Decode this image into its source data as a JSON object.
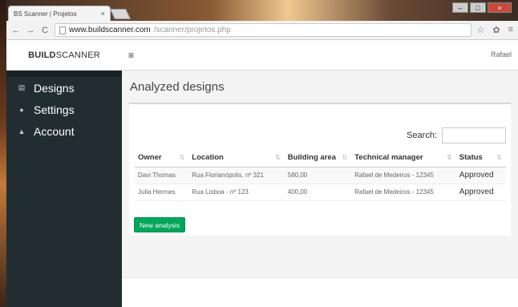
{
  "browser": {
    "tab_title": "BS Scanner | Projetos",
    "tab_close": "×",
    "url_host": "www.buildscanner.com",
    "url_path": "/scanner/projetos.php",
    "win_min": "–",
    "win_max": "□",
    "win_close": "×"
  },
  "app": {
    "brand_bold": "BUILD",
    "brand_light": "SCANNER",
    "menu_glyph": "≡",
    "user_name": "Rafael"
  },
  "sidebar": {
    "items": [
      {
        "label": "Designs",
        "icon": "document-icon"
      },
      {
        "label": "Settings",
        "icon": "gear-icon"
      },
      {
        "label": "Account",
        "icon": "user-icon"
      }
    ]
  },
  "main": {
    "title": "Analyzed designs",
    "search_label": "Search:",
    "search_value": "",
    "columns": [
      "Owner",
      "Location",
      "Building area",
      "Technical manager",
      "Status"
    ],
    "rows": [
      [
        "Davi Thomas",
        "Rua Florianópolis, nº 321",
        "580,00",
        "Rafael de Medeiros - 12345",
        "Approved"
      ],
      [
        "Julia Hermes",
        "Rua Lisboa - nº 123",
        "400,00",
        "Rafael de Medeiros - 12345",
        "Approved"
      ]
    ],
    "new_button": "New analysis"
  }
}
